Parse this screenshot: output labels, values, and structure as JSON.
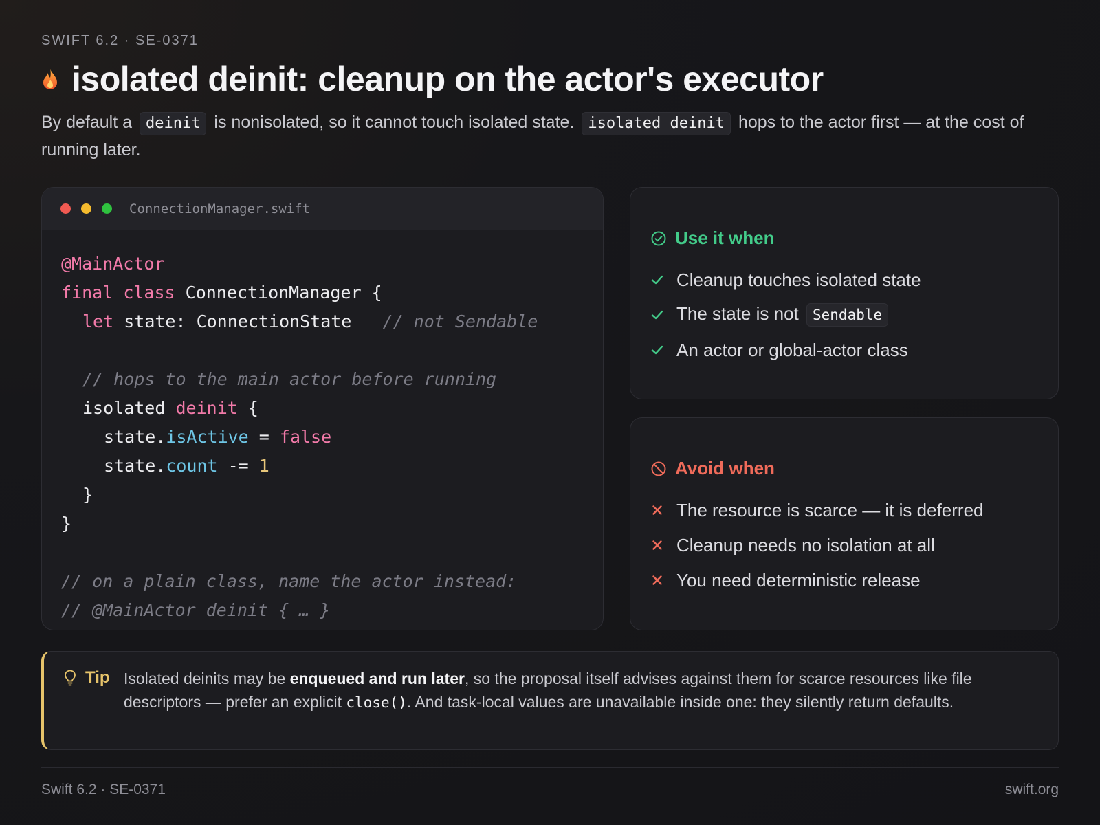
{
  "header": {
    "eyebrow": "SWIFT 6.2 · SE-0371",
    "title": "isolated deinit: cleanup on the actor's executor",
    "icon": "flame-icon"
  },
  "intro": {
    "part1": "By default a",
    "code1": "deinit",
    "part2": "is nonisolated, so it cannot touch isolated state.",
    "code2": "isolated deinit",
    "part3": "hops to the actor first — at the cost of running later."
  },
  "code_window": {
    "filename": "ConnectionManager.swift",
    "lines": {
      "l1": "@MainActor",
      "l2_kw1": "final",
      "l2_kw2": "class",
      "l2_rest": "ConnectionManager {",
      "l3_kw": "let",
      "l3_rest": "state: ConnectionState",
      "l3_comment": "// not Sendable",
      "l5_comment": "// hops to the main actor before running",
      "l6_a": "isolated",
      "l6_kw": "deinit",
      "l6_b": "{",
      "l7_a": "state.",
      "l7_prop": "isActive",
      "l7_op": " = ",
      "l7_val": "false",
      "l8_a": "state.",
      "l8_prop": "count",
      "l8_op": " -= ",
      "l8_val": "1",
      "l9": "}",
      "l10": "}",
      "l12_comment": "// on a plain class, name the actor instead:",
      "l13_comment": "// @MainActor deinit { … }"
    }
  },
  "use_card": {
    "title": "Use it when",
    "items": [
      "Cleanup touches isolated state",
      "The state is not",
      "An actor or global-actor class"
    ],
    "item2_code": "Sendable",
    "accent": "#43cc8a"
  },
  "avoid_card": {
    "title": "Avoid when",
    "items": [
      "The resource is scarce — it is deferred",
      "Cleanup needs no isolation at all",
      "You need deterministic release"
    ],
    "accent": "#ef6b5a"
  },
  "tip": {
    "label": "Tip",
    "text1": "Isolated deinits may be",
    "bold": "enqueued and run later",
    "text2": ", so the proposal itself advises against them for scarce resources like file descriptors — prefer an explicit",
    "code": "close()",
    "text3": ". And task-local values are unavailable inside one: they silently return defaults.",
    "accent": "#e6c36a"
  },
  "footer": {
    "left": "Swift 6.2 · SE-0371",
    "right": "swift.org"
  }
}
